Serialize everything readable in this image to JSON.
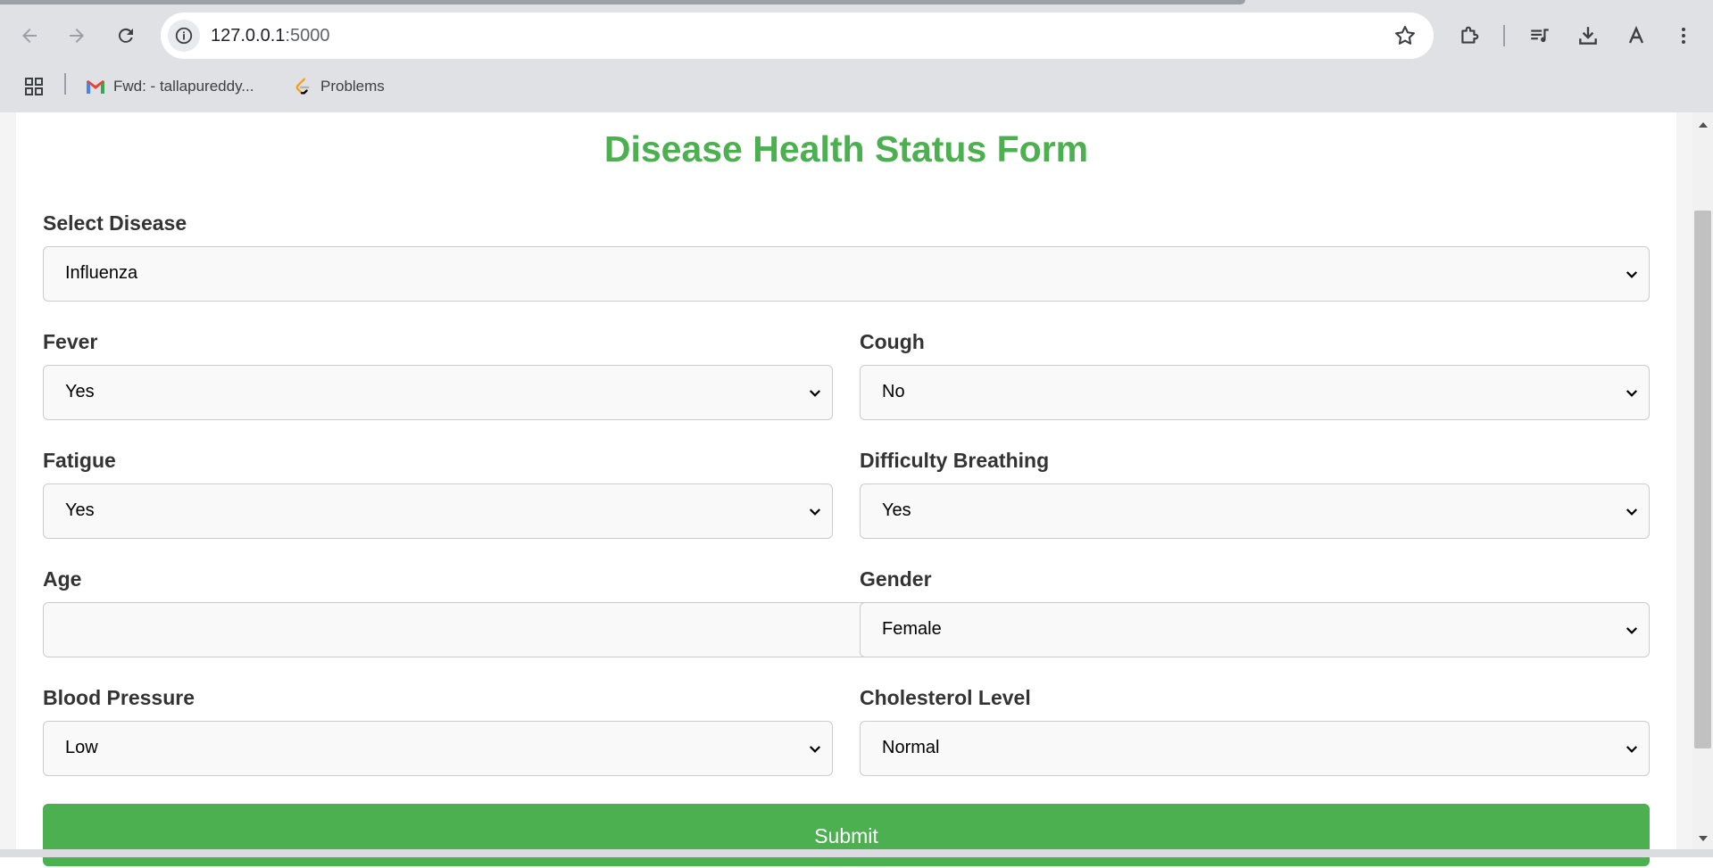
{
  "browser": {
    "url_host": "127.0.0.1",
    "url_port": ":5000",
    "bookmarks": [
      {
        "label": "Fwd: - tallapureddy...",
        "icon": "gmail-icon"
      },
      {
        "label": "Problems",
        "icon": "leetcode-icon"
      }
    ]
  },
  "form": {
    "title": "Disease Health Status Form",
    "fields": {
      "disease": {
        "label": "Select Disease",
        "value": "Influenza"
      },
      "fever": {
        "label": "Fever",
        "value": "Yes"
      },
      "cough": {
        "label": "Cough",
        "value": "No"
      },
      "fatigue": {
        "label": "Fatigue",
        "value": "Yes"
      },
      "breathing": {
        "label": "Difficulty Breathing",
        "value": "Yes"
      },
      "age": {
        "label": "Age",
        "value": ""
      },
      "gender": {
        "label": "Gender",
        "value": "Female"
      },
      "bp": {
        "label": "Blood Pressure",
        "value": "Low"
      },
      "cholesterol": {
        "label": "Cholesterol Level",
        "value": "Normal"
      }
    },
    "submit_label": "Submit"
  },
  "colors": {
    "accent": "#4caf50",
    "label": "#333333",
    "field_bg": "#f9f9f9",
    "field_border": "#cccccc"
  }
}
